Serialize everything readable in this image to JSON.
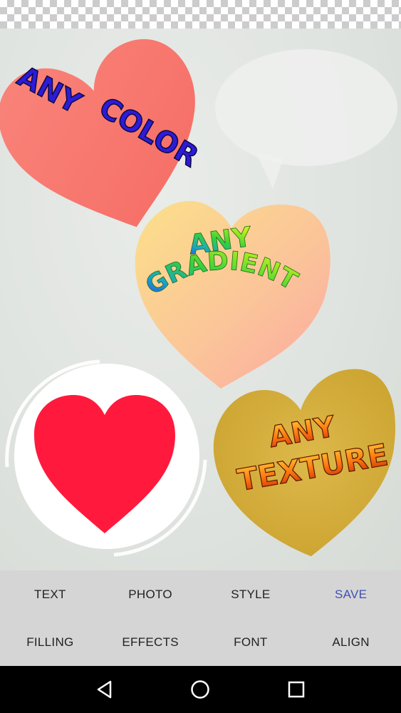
{
  "canvas": {
    "sticker_texts": {
      "color_line1": "ANY",
      "color_line2": "COLOR",
      "gradient_line1": "ANY",
      "gradient_line2": "GRADIENT",
      "texture_line1": "ANY",
      "texture_line2": "TEXTURE"
    },
    "colors": {
      "coral_heart": "#f8776e",
      "peach_heart_top": "#fbe08a",
      "peach_heart_bottom": "#fbb0a3",
      "gold_heart": "#d6b13c",
      "red_heart": "#ff1a3d",
      "text_blue": "#2d1bd8"
    }
  },
  "toolbar": {
    "row1": [
      "TEXT",
      "PHOTO",
      "STYLE",
      "SAVE"
    ],
    "row2": [
      "FILLING",
      "EFFECTS",
      "FONT",
      "ALIGN"
    ],
    "accent": "#3f51b5"
  },
  "navbar": {
    "icons": [
      "back-icon",
      "home-icon",
      "recents-icon"
    ]
  }
}
